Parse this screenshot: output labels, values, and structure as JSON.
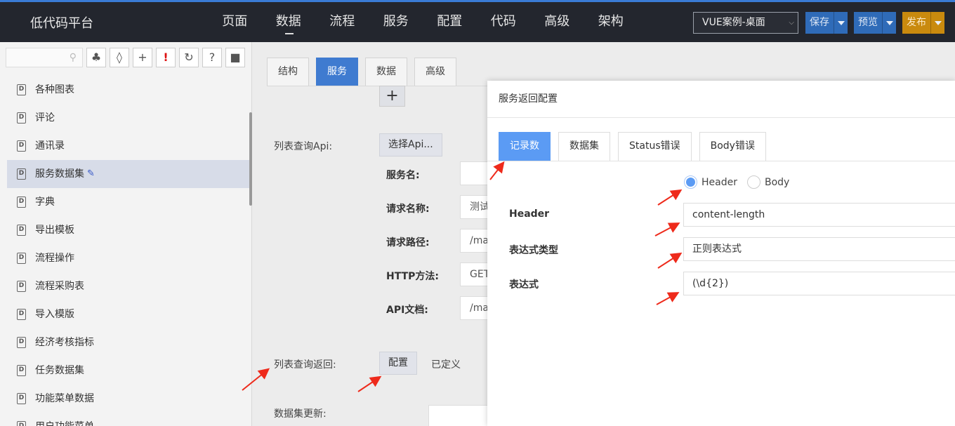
{
  "app": {
    "title": "低代码平台"
  },
  "nav": {
    "items": [
      "页面",
      "数据",
      "流程",
      "服务",
      "配置",
      "代码",
      "高级",
      "架构"
    ],
    "active_index": 1
  },
  "header": {
    "project_select": "VUE案例-桌面",
    "save_label": "保存",
    "preview_label": "预览",
    "publish_label": "发布"
  },
  "toolbar": {
    "icons": [
      "tree-icon",
      "tag-icon",
      "plus-icon",
      "alert-icon",
      "refresh-icon",
      "help-icon",
      "window-icon"
    ]
  },
  "sidebar": {
    "items": [
      {
        "label": "各种图表"
      },
      {
        "label": "评论"
      },
      {
        "label": "通讯录"
      },
      {
        "label": "服务数据集",
        "active": true
      },
      {
        "label": "字典"
      },
      {
        "label": "导出模板"
      },
      {
        "label": "流程操作"
      },
      {
        "label": "流程采购表"
      },
      {
        "label": "导入模版"
      },
      {
        "label": "经济考核指标"
      },
      {
        "label": "任务数据集"
      },
      {
        "label": "功能菜单数据"
      },
      {
        "label": "用户功能菜单"
      }
    ]
  },
  "main": {
    "tabs": [
      "结构",
      "服务",
      "数据",
      "高级"
    ],
    "active_tab": 1,
    "list_api_label": "列表查询Api:",
    "select_api_label": "选择Api...",
    "service_name_label": "服务名:",
    "request_name_label": "请求名称:",
    "request_name_value": "测试",
    "request_path_label": "请求路径:",
    "request_path_value": "/ma",
    "http_method_label": "HTTP方法:",
    "http_method_value": "GET",
    "api_doc_label": "API文档:",
    "api_doc_value": "/ma",
    "list_return_label": "列表查询返回:",
    "config_button": "配置",
    "defined_label": "已定义",
    "dataset_update_label": "数据集更新:"
  },
  "dialog": {
    "title": "服务返回配置",
    "tabs": [
      "记录数",
      "数据集",
      "Status错误",
      "Body错误"
    ],
    "active_tab": 0,
    "radio_header": "Header",
    "radio_body": "Body",
    "radio_selected": "Header",
    "header_label": "Header",
    "header_value": "content-length",
    "expr_type_label": "表达式类型",
    "expr_type_value": "正则表达式",
    "expr_label": "表达式",
    "expr_value": "(\\d{2})"
  },
  "colors": {
    "topbar_bg": "#23262e",
    "save_button": "#2f6bb8",
    "publish_button": "#c98a0e",
    "active_tab": "#3f7bd0",
    "dialog_active_tab": "#5b9bf4",
    "annotation_arrow": "#ee2a1b"
  }
}
